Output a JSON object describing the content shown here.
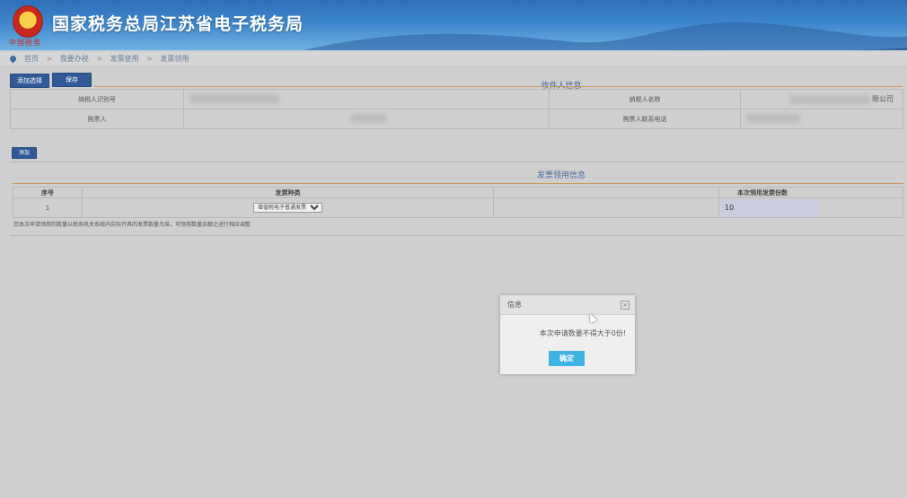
{
  "header": {
    "site_title": "国家税务总局江苏省电子税务局",
    "emblem_label": "中国税务"
  },
  "breadcrumb": {
    "items": [
      "首页",
      "我要办税",
      "发票使用",
      "发票领用"
    ],
    "separator": ">"
  },
  "toolbar": {
    "buttons": [
      "添加选择",
      "保存"
    ]
  },
  "recipient": {
    "section_title": "收件人信息",
    "taxpayer_id_label": "纳税人识别号",
    "taxpayer_name_label": "纳税人名称",
    "taxpayer_name_value_tail": "限公司",
    "purchaser_label": "购票人",
    "purchaser_phone_label": "购票人联系电话"
  },
  "invoice_section": {
    "add_button": "添加",
    "section_title": "发票领用信息",
    "columns": [
      "序号",
      "发票种类",
      "本次领用发票份数"
    ],
    "rows": [
      {
        "index": "1",
        "kind": "增值税电子普通发票",
        "count": "10"
      }
    ],
    "note": "您本次申请领用的数量以税务机关系统内实际开具的发票数量为准，可领用数量余额之进行相应调整"
  },
  "dialog": {
    "title": "信息",
    "close_icon": "close-icon",
    "message": "本次申请数量不得大于0份!",
    "ok_label": "确定"
  },
  "colors": {
    "banner": "#3d86cc",
    "button": "#2f5a95",
    "ok_button": "#3fb3e2"
  }
}
